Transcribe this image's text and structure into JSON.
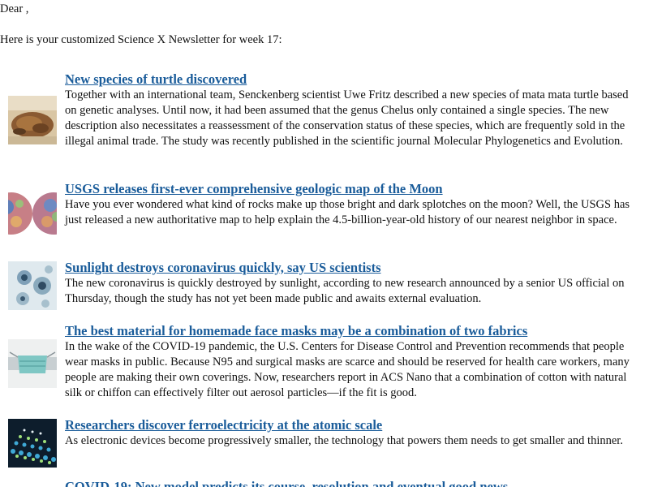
{
  "greeting": "Dear ,",
  "intro": "Here is your customized Science X Newsletter for week 17:",
  "articles": [
    {
      "title": "New species of turtle discovered",
      "summary": "Together with an international team, Senckenberg scientist Uwe Fritz described a new species of mata mata turtle based on genetic analyses. Until now, it had been assumed that the genus Chelus only contained a single species. The new description also necessitates a reassessment of the conservation status of these species, which are frequently sold in the illegal animal trade. The study was recently published in the scientific journal Molecular Phylogenetics and Evolution.",
      "thumbnail": "turtle-photo"
    },
    {
      "title": "USGS releases first-ever comprehensive geologic map of the Moon",
      "summary": "Have you ever wondered what kind of rocks make up those bright and dark splotches on the moon? Well, the USGS has just released a new authoritative map to help explain the 4.5-billion-year-old history of our nearest neighbor in space.",
      "thumbnail": "moon-geologic-map"
    },
    {
      "title": "Sunlight destroys coronavirus quickly, say US scientists",
      "summary": "The new coronavirus is quickly destroyed by sunlight, according to new research announced by a senior US official on Thursday, though the study has not yet been made public and awaits external evaluation.",
      "thumbnail": "coronavirus-micrograph"
    },
    {
      "title": "The best material for homemade face masks may be a combination of two fabrics",
      "summary": "In the wake of the COVID-19 pandemic, the U.S. Centers for Disease Control and Prevention recommends that people wear masks in public. Because N95 and surgical masks are scarce and should be reserved for health care workers, many people are making their own coverings. Now, researchers report in ACS Nano that a combination of cotton with natural silk or chiffon can effectively filter out aerosol particles—if the fit is good.",
      "thumbnail": "face-mask-photo"
    },
    {
      "title": "Researchers discover ferroelectricity at the atomic scale",
      "summary": "As electronic devices become progressively smaller, the technology that powers them needs to get smaller and thinner.",
      "thumbnail": "atomic-lattice-image"
    },
    {
      "title": "COVID-19: New model predicts its course, resolution and eventual good news",
      "summary": "",
      "thumbnail": ""
    }
  ],
  "colors": {
    "link": "#1a5c9a",
    "text": "#111111",
    "background": "#ffffff"
  }
}
